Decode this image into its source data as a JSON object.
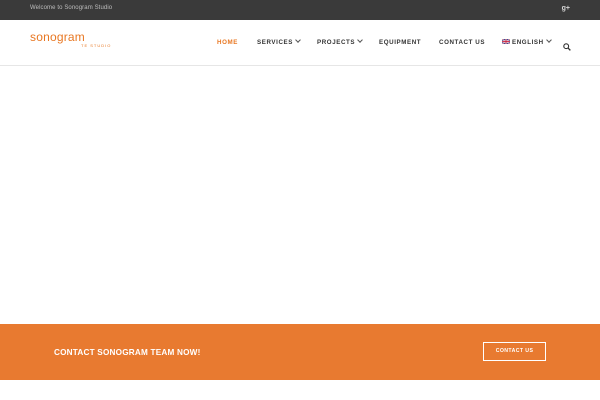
{
  "topbar": {
    "welcome_text": "Welcome to Sonogram Studio",
    "social_icon": "google-plus-icon",
    "social_label": "g+"
  },
  "header": {
    "logo_text": "sonogram",
    "logo_subtext": "TE STUDIO",
    "brand_color": "#e87722",
    "nav": {
      "home": "HOME",
      "services": "SERVICES",
      "projects": "PROJECTS",
      "equipment": "EQUIPMENT",
      "contact": "CONTACT US",
      "language": "ENGLISH"
    },
    "search_icon": "search-icon"
  },
  "cta": {
    "text": "CONTACT SONOGRAM TEAM NOW!",
    "button_label": "CONTACT US",
    "background": "#e87a30"
  }
}
